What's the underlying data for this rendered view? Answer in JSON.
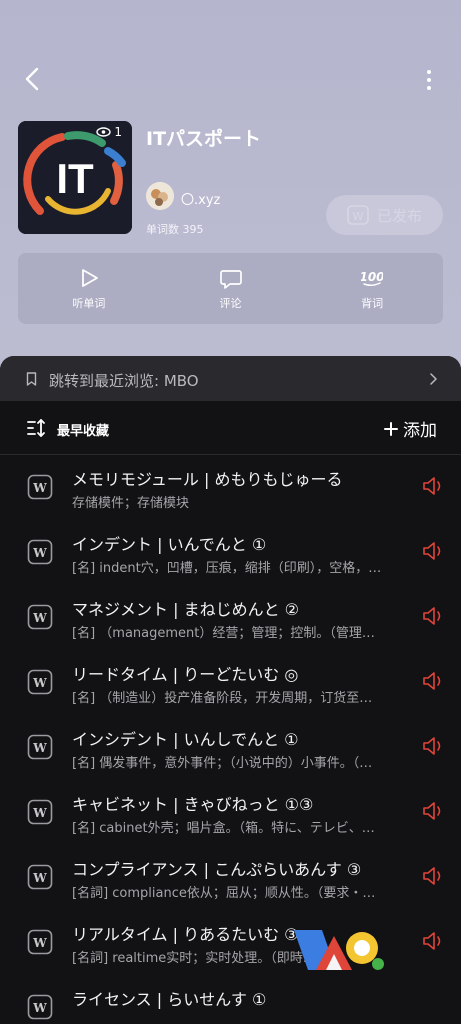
{
  "header": {
    "back_icon": "back-arrow-icon",
    "more_icon": "more-vertical-icon"
  },
  "book": {
    "cover_text": "IT",
    "views": "1",
    "title": "ITパスポート",
    "author": "〇.xyz",
    "word_count": "单词数 395",
    "publish_label": "已发布"
  },
  "actions": [
    {
      "icon": "play-icon",
      "label": "听单词"
    },
    {
      "icon": "comment-icon",
      "label": "评论"
    },
    {
      "icon": "score-100-icon",
      "label": "背词"
    }
  ],
  "jump": {
    "text": "跳转到最近浏览: MBO"
  },
  "toolbar": {
    "sort_label": "最早收藏",
    "add_label": "添加"
  },
  "words": [
    {
      "word": "メモリモジュール | めもりもじゅーる",
      "def": "存储模件；存储模块"
    },
    {
      "word": "インデント | いんでんと ①",
      "def": "[名] indent穴，凹槽，压痕，缩排（印刷），空格，…"
    },
    {
      "word": "マネジメント | まねじめんと ②",
      "def": "[名] （management）经营；管理；控制。（管理…"
    },
    {
      "word": "リードタイム | りーどたいむ ◎",
      "def": "[名] （制造业）投产准备阶段，开发周期，订货至…"
    },
    {
      "word": "インシデント | いんしでんと ①",
      "def": "[名] 偶发事件，意外事件；（小说中的）小事件。（…"
    },
    {
      "word": "キャビネット | きゃびねっと ①③",
      "def": "[名] cabinet外壳；唱片盒。（箱。特に、テレビ、…"
    },
    {
      "word": "コンプライアンス | こんぷらいあんす ③",
      "def": "[名詞] compliance依从；屈从；顺从性。（要求・…"
    },
    {
      "word": "リアルタイム | りあるたいむ ③",
      "def": "[名詞] realtime实时；实时处理。（即時…"
    },
    {
      "word": "ライセンス | らいせんす ①",
      "def": ""
    }
  ],
  "colors": {
    "accent_speaker": "#e0453a",
    "sheet_bg": "#121214"
  }
}
